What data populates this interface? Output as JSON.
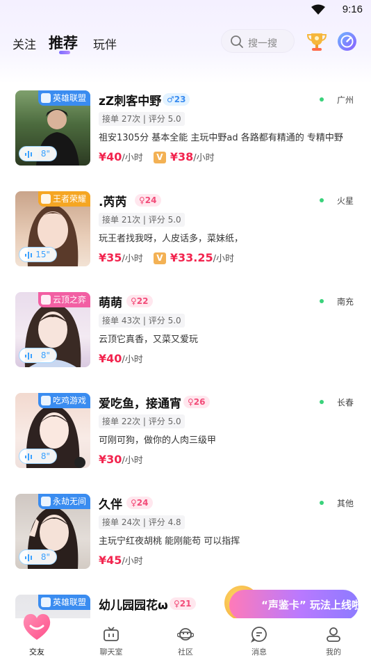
{
  "status_bar": {
    "time": "9:16"
  },
  "header": {
    "tabs": [
      {
        "label": "关注",
        "active": false
      },
      {
        "label": "推荐",
        "active": true
      },
      {
        "label": "玩伴",
        "active": false
      }
    ],
    "search_placeholder": "搜一搜",
    "icons": [
      "search-icon",
      "trophy-icon",
      "compass-icon"
    ]
  },
  "colors": {
    "accent": "#7a6cff",
    "price": "#f2244e",
    "online": "#3ad27b"
  },
  "cards": [
    {
      "game": "英雄联盟",
      "game_color": "#3a8cf0",
      "voice": "8\"",
      "name": "zZ刺客中野",
      "age": "23",
      "gender": "male",
      "city": "广州",
      "stats": "接单 27次 | 评分 5.0",
      "desc": "祖安1305分  基本全能 主玩中野ad  各路都有精通的 专精中野",
      "price": "¥40",
      "unit": "/小时",
      "vip_badge": "V",
      "vip_price": "¥38",
      "vip_unit": "/小时"
    },
    {
      "game": "王者荣耀",
      "game_color": "#f5a623",
      "voice": "15\"",
      "name": "⁠.芮芮",
      "age": "24",
      "gender": "female",
      "city": "火星",
      "stats": "接单 21次 | 评分 5.0",
      "desc": "玩王者找我呀，人皮话多，菜妹纸，",
      "price": "¥35",
      "unit": "/小时",
      "vip_badge": "V",
      "vip_price": "¥33.25",
      "vip_unit": "/小时"
    },
    {
      "game": "云顶之弈",
      "game_color": "#f25fa3",
      "voice": "8\"",
      "name": "萌萌",
      "age": "22",
      "gender": "female",
      "city": "南充",
      "stats": "接单 43次 | 评分 5.0",
      "desc": "云顶它真香，又菜又爱玩",
      "price": "¥40",
      "unit": "/小时",
      "vip_badge": "",
      "vip_price": "",
      "vip_unit": ""
    },
    {
      "game": "吃鸡游戏",
      "game_color": "#3a8cf0",
      "voice": "8\"",
      "name": "爱吃鱼，接通宵",
      "age": "26",
      "gender": "female",
      "city": "长春",
      "stats": "接单 22次 | 评分 5.0",
      "desc": "可刚可狗，做你的人肉三级甲",
      "price": "¥30",
      "unit": "/小时",
      "vip_badge": "",
      "vip_price": "",
      "vip_unit": ""
    },
    {
      "game": "永劫无间",
      "game_color": "#3a8cf0",
      "voice": "8\"",
      "name": "久伴",
      "age": "24",
      "gender": "female",
      "city": "其他",
      "stats": "接单 24次 | 评分 4.8",
      "desc": "主玩宁红夜胡桃 能刚能苟 可以指挥",
      "price": "¥45",
      "unit": "/小时",
      "vip_badge": "",
      "vip_price": "",
      "vip_unit": ""
    },
    {
      "game": "英雄联盟",
      "game_color": "#3a8cf0",
      "voice": "",
      "name": "幼儿园园花ω",
      "age": "21",
      "gender": "female",
      "city": "",
      "stats": "",
      "desc": "",
      "price": "",
      "unit": "",
      "vip_badge": "",
      "vip_price": "",
      "vip_unit": ""
    }
  ],
  "promo": {
    "text": "“声鉴卡” 玩法上线啦"
  },
  "bottom_nav": [
    {
      "label": "交友",
      "icon": "heart-icon",
      "active": true
    },
    {
      "label": "聊天室",
      "icon": "tv-icon",
      "active": false
    },
    {
      "label": "社区",
      "icon": "planet-icon",
      "active": false
    },
    {
      "label": "消息",
      "icon": "message-icon",
      "active": false
    },
    {
      "label": "我的",
      "icon": "profile-icon",
      "active": false
    }
  ]
}
